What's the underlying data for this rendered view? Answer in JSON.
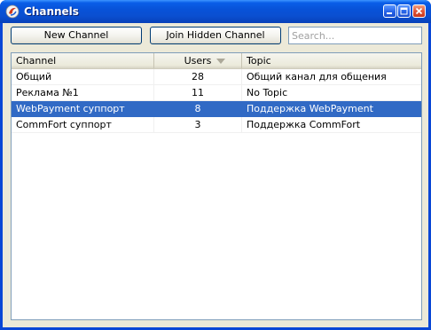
{
  "window": {
    "title": "Channels",
    "controls": {
      "minimize_icon": "minimize-icon",
      "maximize_icon": "maximize-icon",
      "close_icon": "close-icon"
    }
  },
  "toolbar": {
    "new_channel_label": "New Channel",
    "join_hidden_label": "Join Hidden Channel",
    "search_placeholder": "Search...",
    "search_value": ""
  },
  "table": {
    "columns": {
      "channel": "Channel",
      "users": "Users",
      "topic": "Topic"
    },
    "sort": {
      "column": "users",
      "direction": "descending"
    },
    "rows": [
      {
        "channel": "Общий",
        "users": "28",
        "topic": "Общий канал для общения",
        "selected": false
      },
      {
        "channel": "Реклама №1",
        "users": "11",
        "topic": "No Topic",
        "selected": false
      },
      {
        "channel": "WebPayment суппорт",
        "users": "8",
        "topic": "Поддержка WebPayment",
        "selected": true
      },
      {
        "channel": "CommFort суппорт",
        "users": "3",
        "topic": "Поддержка CommFort",
        "selected": false
      }
    ]
  },
  "colors": {
    "titlebar": "#0a4fd0",
    "selection": "#316ac5",
    "client_bg": "#ece9d8"
  }
}
